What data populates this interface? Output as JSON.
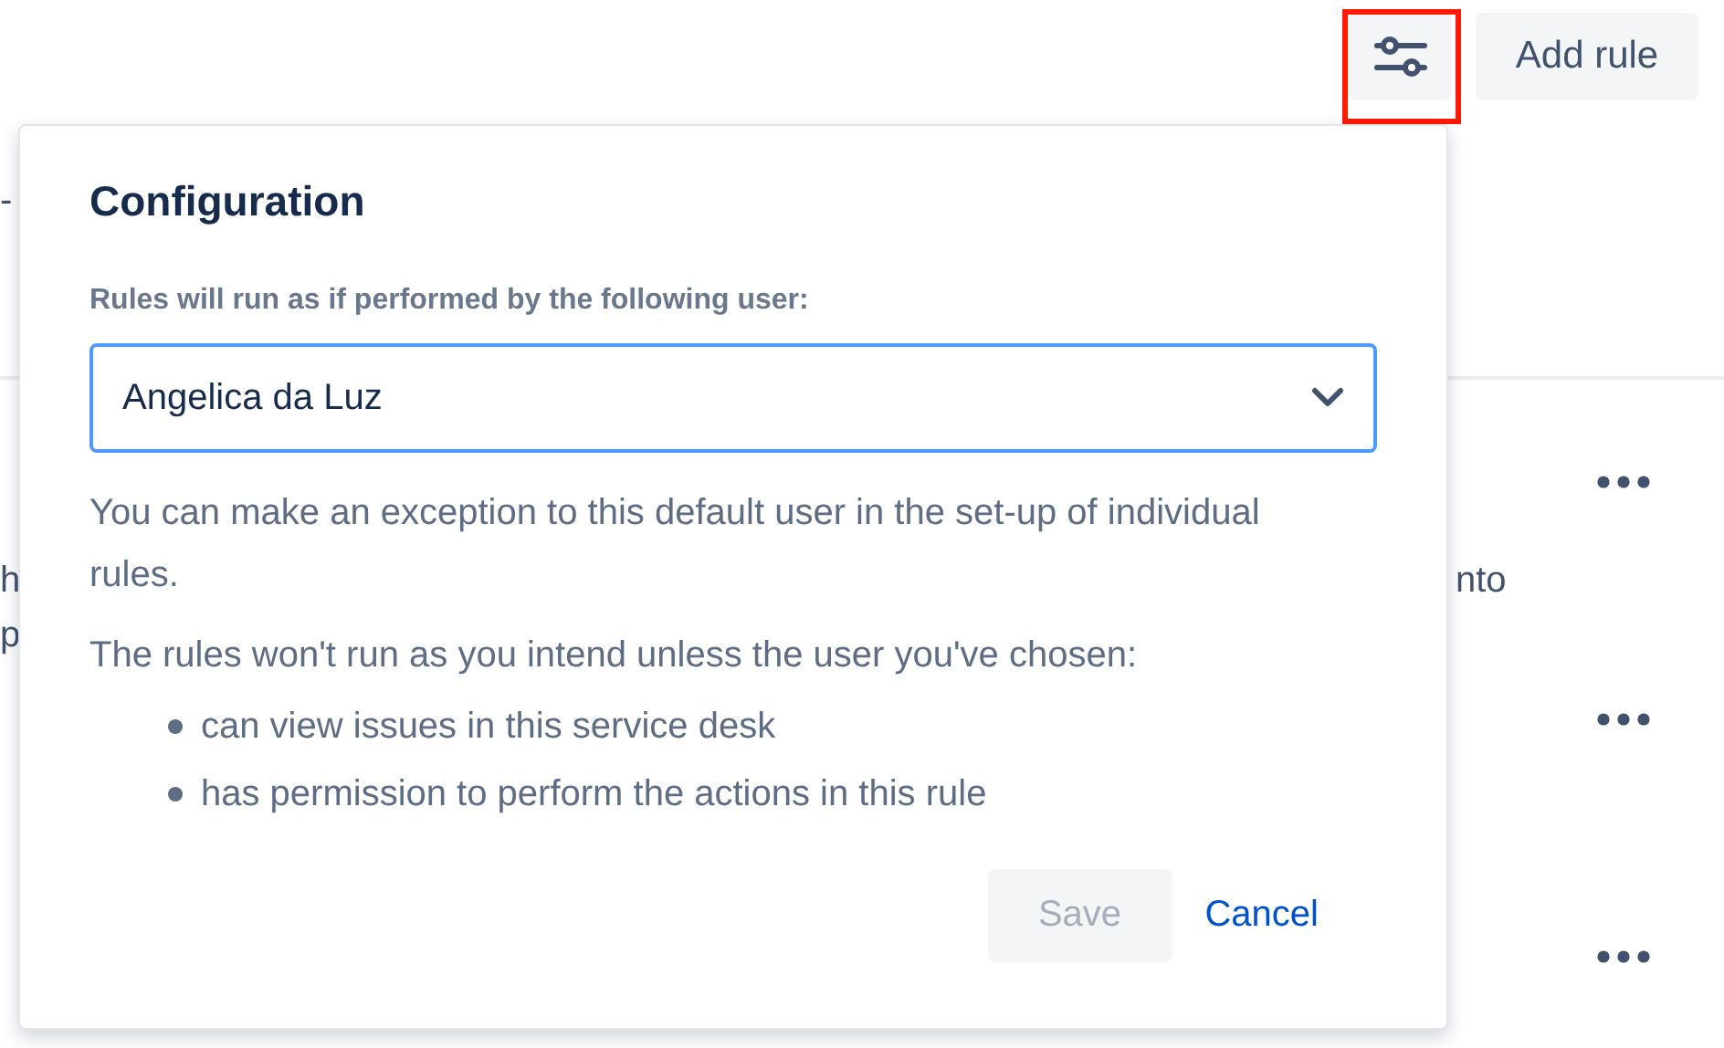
{
  "toolbar": {
    "settings_button": {
      "highlighted": true
    },
    "add_rule_button": "Add rule"
  },
  "background": {
    "heading_fragment": "-",
    "rows": [
      {
        "kind": "menu-row",
        "left_lines": [
          "h",
          "p"
        ],
        "right_fragment": "nto"
      },
      {
        "kind": "menu-row"
      },
      {
        "kind": "menu-row"
      }
    ]
  },
  "dialog": {
    "title": "Configuration",
    "field_label": "Rules will run as if performed by the following user:",
    "user_select": {
      "value": "Angelica da Luz"
    },
    "paragraphs": [
      "You can make an exception to this default user in the set-up of individual rules.",
      "The rules won't run as you intend unless the user you've chosen:"
    ],
    "bullets": [
      "can view issues in this service desk",
      "has permission to perform the actions in this rule"
    ],
    "save_button": {
      "label": "Save",
      "disabled": true
    },
    "cancel_link": "Cancel"
  }
}
